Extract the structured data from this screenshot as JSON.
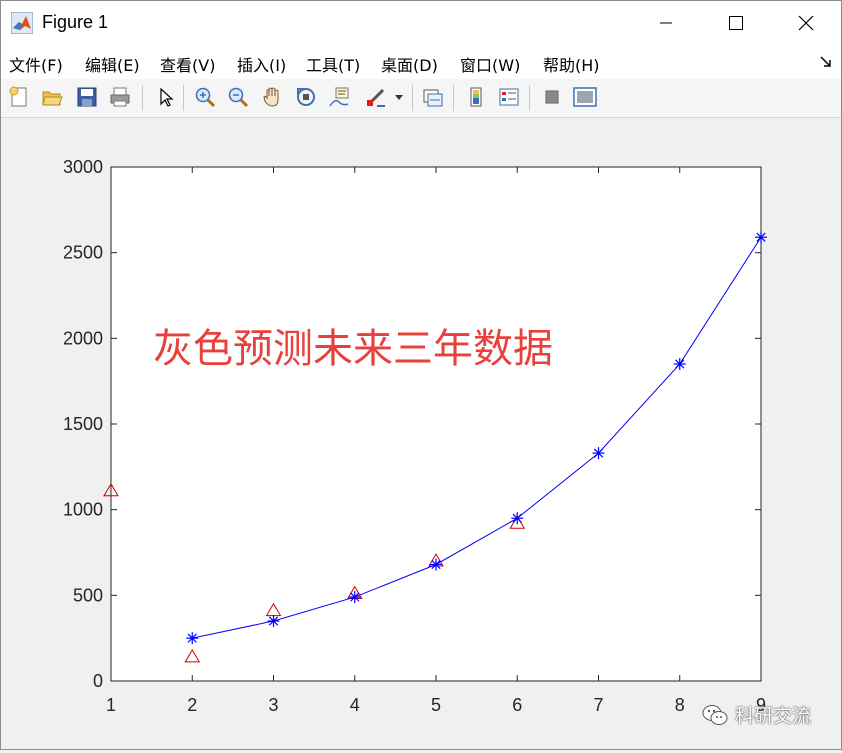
{
  "window": {
    "title": "Figure 1"
  },
  "menu": {
    "items": [
      "文件(F)",
      "编辑(E)",
      "查看(V)",
      "插入(I)",
      "工具(T)",
      "桌面(D)",
      "窗口(W)",
      "帮助(H)"
    ]
  },
  "toolbar": {
    "buttons": [
      "new-figure-icon",
      "open-file-icon",
      "save-icon",
      "print-icon",
      "pointer-icon",
      "zoom-in-icon",
      "zoom-out-icon",
      "pan-hand-icon",
      "rotate-3d-icon",
      "data-cursor-icon",
      "brush-icon",
      "brush-dropdown-icon",
      "link-plot-icon",
      "colorbar-icon",
      "legend-icon",
      "hide-plot-tools-icon",
      "show-plot-tools-icon"
    ]
  },
  "chart_data": {
    "type": "line",
    "xlim": [
      1,
      9
    ],
    "ylim": [
      0,
      3000
    ],
    "x_ticks": [
      "1",
      "2",
      "3",
      "4",
      "5",
      "6",
      "7",
      "8",
      "9"
    ],
    "y_ticks": [
      "0",
      "500",
      "1000",
      "1500",
      "2000",
      "2500",
      "3000"
    ],
    "annotation": "灰色预测未来三年数据",
    "annotation_color": "#e8413b",
    "grid": false,
    "series": [
      {
        "marker": "triangle",
        "color": "#cc0000",
        "line": false,
        "x": [
          1,
          2,
          3,
          4,
          5,
          6
        ],
        "y": [
          1110,
          140,
          410,
          510,
          700,
          920
        ]
      },
      {
        "marker": "asterisk",
        "color": "#0000ff",
        "line": true,
        "x": [
          2,
          3,
          4,
          5,
          6,
          7,
          8,
          9
        ],
        "y": [
          250,
          350,
          490,
          680,
          950,
          1330,
          1850,
          2590
        ]
      }
    ]
  },
  "watermark": {
    "text": "科研交流"
  }
}
